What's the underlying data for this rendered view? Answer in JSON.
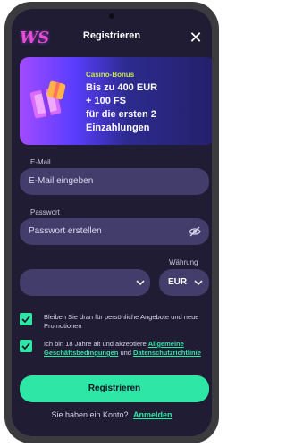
{
  "header": {
    "logo_text": "WS",
    "title": "Registrieren",
    "close_glyph": "✕"
  },
  "bonus": {
    "label": "Casino-Bonus",
    "lines": [
      "Bis zu 400 EUR",
      "+ 100 FS",
      "für die ersten 2",
      "Einzahlungen"
    ]
  },
  "form": {
    "email_label": "E-Mail",
    "email_placeholder": "E-Mail eingeben",
    "password_label": "Passwort",
    "password_placeholder": "Passwort erstellen",
    "currency_label": "Währung",
    "country_value": "",
    "currency_value": "EUR"
  },
  "checkboxes": {
    "promo_text": "Bleiben Sie dran für persönliche Angebote und neue Promotionen",
    "terms_prefix": "Ich bin 18 Jahre alt und akzeptiere",
    "terms_link": "Allgemeine Geschäftsbedingungen",
    "terms_middle": "und",
    "privacy_link": "Datenschutzrichtlinie"
  },
  "submit_label": "Registrieren",
  "footer": {
    "question": "Sie haben ein Konto?",
    "login_link": "Anmelden"
  },
  "colors": {
    "background": "#1f1c33",
    "input": "#433d6b",
    "accent": "#2ee6a6",
    "bonus_highlight": "#c7e84a"
  },
  "icons": [
    "logo-icon",
    "close-icon",
    "gift-icon",
    "eye-off-icon",
    "chevron-down-icon",
    "checkmark-icon"
  ]
}
